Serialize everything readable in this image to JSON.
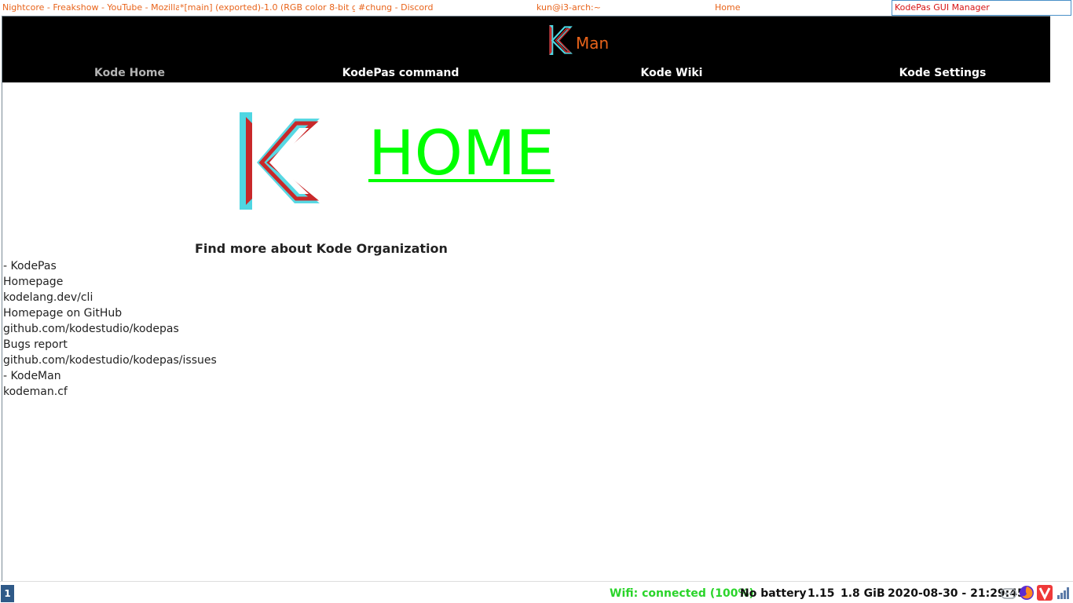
{
  "tabs": [
    {
      "title": "Nightcore - Freakshow - YouTube - Mozilla ..."
    },
    {
      "title": "*[main] (exported)-1.0 (RGB color 8-bit ga..."
    },
    {
      "title": "#chung - Discord"
    },
    {
      "title": "kun@i3-arch:~"
    },
    {
      "title": "Home"
    },
    {
      "title": "KodePas GUI Manager",
      "active": true
    }
  ],
  "app": {
    "logo_text": "Man",
    "nav": [
      {
        "label": "Kode Home",
        "active": true
      },
      {
        "label": "KodePas command"
      },
      {
        "label": "Kode Wiki"
      },
      {
        "label": "Kode Settings"
      }
    ],
    "page_title": "HOME",
    "about_heading": "Find more about Kode Organization",
    "links": [
      "- KodePas",
      "Homepage",
      "kodelang.dev/cli",
      "Homepage on GitHub",
      "github.com/kodestudio/kodepas",
      "Bugs report",
      "github.com/kodestudio/kodepas/issues",
      "- KodeMan",
      "kodeman.cf"
    ]
  },
  "status": {
    "workspace": "1",
    "wifi": "Wifi: connected (100%)",
    "battery": "No battery",
    "load": "1.15",
    "memory": "1.8 GiB",
    "datetime": "2020-08-30 - 21:29:45"
  },
  "tray_icons": [
    "discord-icon",
    "firefox-icon",
    "vivaldi-icon",
    "network-signal-icon"
  ],
  "colors": {
    "accent_orange": "#e8631a",
    "active_tab_red": "#d71414",
    "home_green": "#00ff00",
    "wifi_green": "#2ad42a",
    "logo_cyan": "#4fd6e2",
    "logo_red": "#c8282a"
  }
}
